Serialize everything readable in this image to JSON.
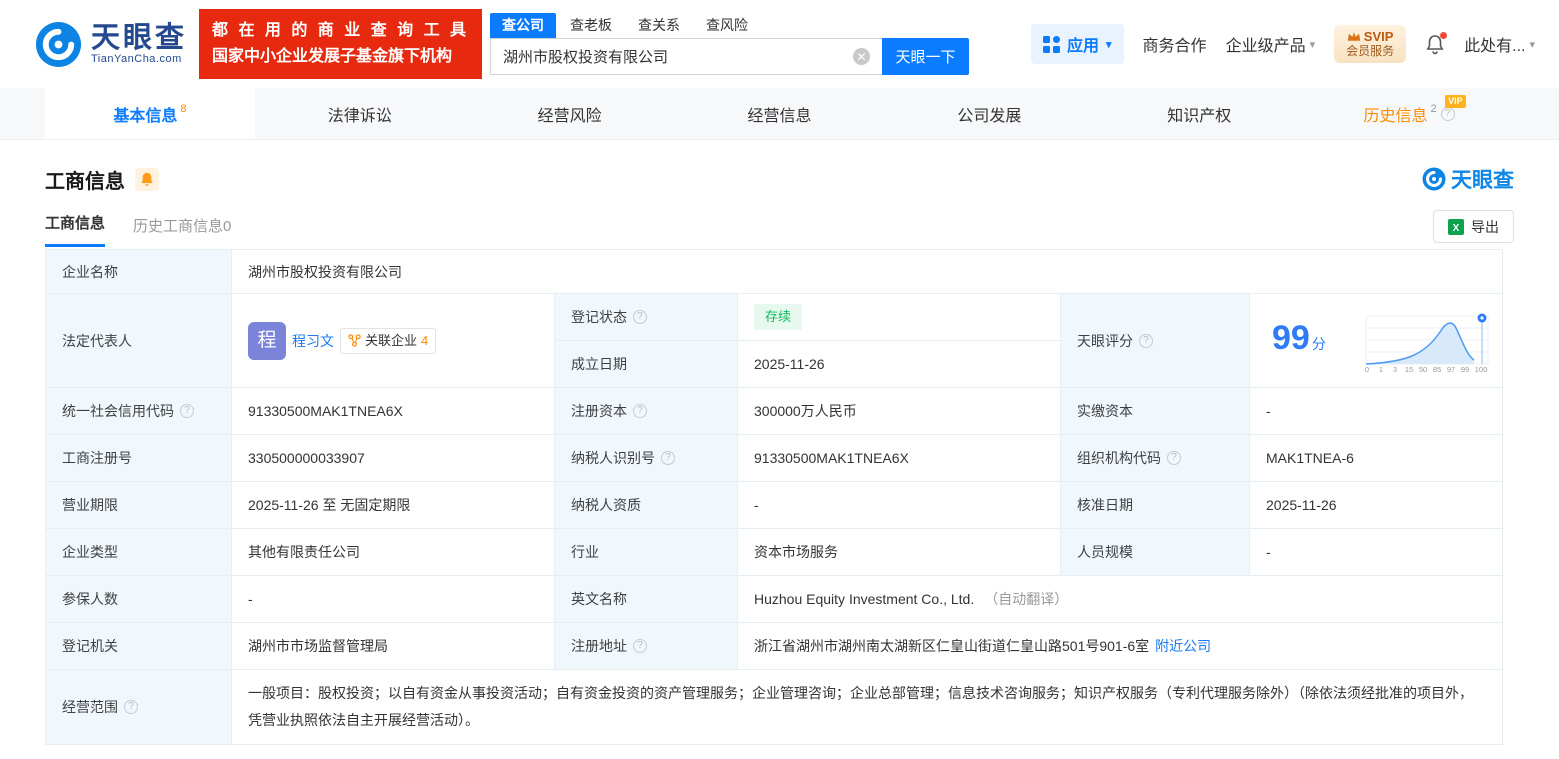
{
  "header": {
    "logo": {
      "cn": "天眼查",
      "en": "TianYanCha.com"
    },
    "promo": {
      "line1": "都 在 用 的 商 业 查 询 工 具",
      "line2": "国家中小企业发展子基金旗下机构"
    },
    "search": {
      "tabs": [
        {
          "label": "查公司"
        },
        {
          "label": "查老板"
        },
        {
          "label": "查关系"
        },
        {
          "label": "查风险"
        }
      ],
      "value": "湖州市股权投资有限公司",
      "button": "天眼一下"
    },
    "right": {
      "apps": "应用",
      "biz": "商务合作",
      "enterprise": "企业级产品",
      "svip_top": "SVIP",
      "svip_bottom": "会员服务",
      "more": "此处有..."
    }
  },
  "nav_tabs": [
    {
      "label": "基本信息",
      "count": "8"
    },
    {
      "label": "法律诉讼"
    },
    {
      "label": "经营风险"
    },
    {
      "label": "经营信息"
    },
    {
      "label": "公司发展"
    },
    {
      "label": "知识产权"
    },
    {
      "label": "历史信息",
      "count": "2",
      "vip": "VIP"
    }
  ],
  "section": {
    "title": "工商信息",
    "corner_logo": "天眼查",
    "subtabs": [
      {
        "label": "工商信息"
      },
      {
        "label": "历史工商信息0"
      }
    ],
    "export": "导出"
  },
  "info": {
    "company_name": {
      "label": "企业名称",
      "value": "湖州市股权投资有限公司"
    },
    "legal_rep": {
      "label": "法定代表人",
      "avatar": "程",
      "name": "程习文",
      "related_label": "关联企业",
      "related_count": "4"
    },
    "reg_status": {
      "label": "登记状态",
      "value": "存续"
    },
    "establish_date": {
      "label": "成立日期",
      "value": "2025-11-26"
    },
    "score": {
      "label": "天眼评分",
      "value": "99",
      "unit": "分",
      "axis": [
        "0",
        "1",
        "3",
        "15",
        "50",
        "85",
        "97",
        "99",
        "100"
      ]
    },
    "credit_code": {
      "label": "统一社会信用代码",
      "value": "91330500MAK1TNEA6X"
    },
    "reg_capital": {
      "label": "注册资本",
      "value": "300000万人民币"
    },
    "paid_capital": {
      "label": "实缴资本",
      "value": "-"
    },
    "reg_number": {
      "label": "工商注册号",
      "value": "330500000033907"
    },
    "taxpayer_id": {
      "label": "纳税人识别号",
      "value": "91330500MAK1TNEA6X"
    },
    "org_code": {
      "label": "组织机构代码",
      "value": "MAK1TNEA-6"
    },
    "business_term": {
      "label": "营业期限",
      "value": "2025-11-26 至 无固定期限"
    },
    "taxpayer_quality": {
      "label": "纳税人资质",
      "value": "-"
    },
    "approval_date": {
      "label": "核准日期",
      "value": "2025-11-26"
    },
    "company_type": {
      "label": "企业类型",
      "value": "其他有限责任公司"
    },
    "industry": {
      "label": "行业",
      "value": "资本市场服务"
    },
    "staff_size": {
      "label": "人员规模",
      "value": "-"
    },
    "insured_count": {
      "label": "参保人数",
      "value": "-"
    },
    "english_name": {
      "label": "英文名称",
      "value": "Huzhou Equity Investment Co., Ltd.",
      "note": "（自动翻译）"
    },
    "reg_authority": {
      "label": "登记机关",
      "value": "湖州市市场监督管理局"
    },
    "address": {
      "label": "注册地址",
      "value": "浙江省湖州市湖州南太湖新区仁皇山街道仁皇山路501号901-6室",
      "link": "附近公司"
    },
    "business_scope": {
      "label": "经营范围",
      "value": "一般项目：股权投资；以自有资金从事投资活动；自有资金投资的资产管理服务；企业管理咨询；企业总部管理；信息技术咨询服务；知识产权服务（专利代理服务除外）（除依法须经批准的项目外，凭营业执照依法自主开展经营活动）。"
    }
  }
}
